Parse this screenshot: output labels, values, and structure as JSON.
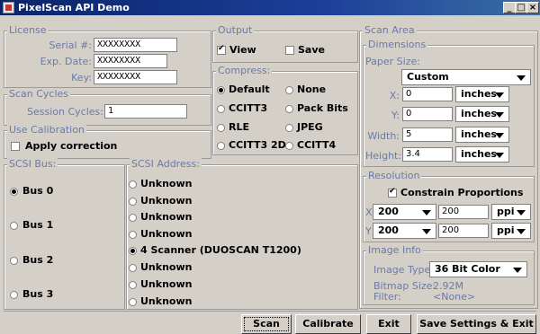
{
  "window": {
    "title": "PixelScan API Demo",
    "min": "_",
    "max": "□",
    "close": "×"
  },
  "license": {
    "legend": "License",
    "serial_label": "Serial #:",
    "serial_value": "XXXXXXXX",
    "exp_label": "Exp. Date:",
    "exp_value": "XXXXXXXX",
    "key_label": "Key:",
    "key_value": "XXXXXXXX"
  },
  "scan_cycles": {
    "legend": "Scan Cycles",
    "session_label": "Session Cycles:",
    "session_value": "1"
  },
  "use_calibration": {
    "legend": "Use Calibration",
    "apply_label": "Apply correction",
    "apply_checked": false
  },
  "output": {
    "legend": "Output",
    "view_label": "View",
    "view_checked": true,
    "save_label": "Save",
    "save_checked": false
  },
  "compress": {
    "legend": "Compress:",
    "options": [
      {
        "label": "Default",
        "selected": true
      },
      {
        "label": "None",
        "selected": false
      },
      {
        "label": "CCITT3",
        "selected": false
      },
      {
        "label": "Pack Bits",
        "selected": false
      },
      {
        "label": "RLE",
        "selected": false
      },
      {
        "label": "JPEG",
        "selected": false
      },
      {
        "label": "CCITT3 2D",
        "selected": false
      },
      {
        "label": "CCITT4",
        "selected": false
      }
    ]
  },
  "scsi_bus": {
    "legend": "SCSI Bus:",
    "buses": [
      {
        "label": "Bus 0",
        "selected": true
      },
      {
        "label": "Bus 1",
        "selected": false
      },
      {
        "label": "Bus 2",
        "selected": false
      },
      {
        "label": "Bus 3",
        "selected": false
      }
    ]
  },
  "scsi_address": {
    "legend": "SCSI Address:",
    "items": [
      {
        "label": "Unknown",
        "selected": false
      },
      {
        "label": "Unknown",
        "selected": false
      },
      {
        "label": "Unknown",
        "selected": false
      },
      {
        "label": "Unknown",
        "selected": false
      },
      {
        "label": "4   Scanner (DUOSCAN T1200)",
        "selected": true
      },
      {
        "label": "Unknown",
        "selected": false
      },
      {
        "label": "Unknown",
        "selected": false
      },
      {
        "label": "Unknown",
        "selected": false
      }
    ]
  },
  "scan_area": {
    "legend": "Scan Area",
    "dimensions": {
      "legend": "Dimensions",
      "paper_size_label": "Paper Size:",
      "paper_size": "Custom",
      "x_label": "X:",
      "x_value": "0",
      "x_unit": "inches",
      "y_label": "Y:",
      "y_value": "0",
      "y_unit": "inches",
      "width_label": "Width:",
      "width_value": "5",
      "width_unit": "inches",
      "height_label": "Height:",
      "height_value": "3.4",
      "height_unit": "inches"
    },
    "resolution": {
      "legend": "Resolution",
      "constrain_label": "Constrain Proportions",
      "constrain_checked": true,
      "x_label": "X",
      "x_select": "200",
      "x_value": "200",
      "x_unit": "ppi",
      "y_label": "Y",
      "y_select": "200",
      "y_value": "200",
      "y_unit": "ppi"
    },
    "image_info": {
      "legend": "Image Info",
      "type_label": "Image Type:",
      "type_value": "36 Bit Color",
      "bitmap_label": "Bitmap Size:",
      "bitmap_value": "2.92M",
      "filter_label": "Filter:",
      "filter_value": "<None>"
    }
  },
  "buttons": {
    "scan": "Scan",
    "calibrate": "Calibrate",
    "exit": "Exit",
    "save_exit": "Save Settings & Exit"
  }
}
